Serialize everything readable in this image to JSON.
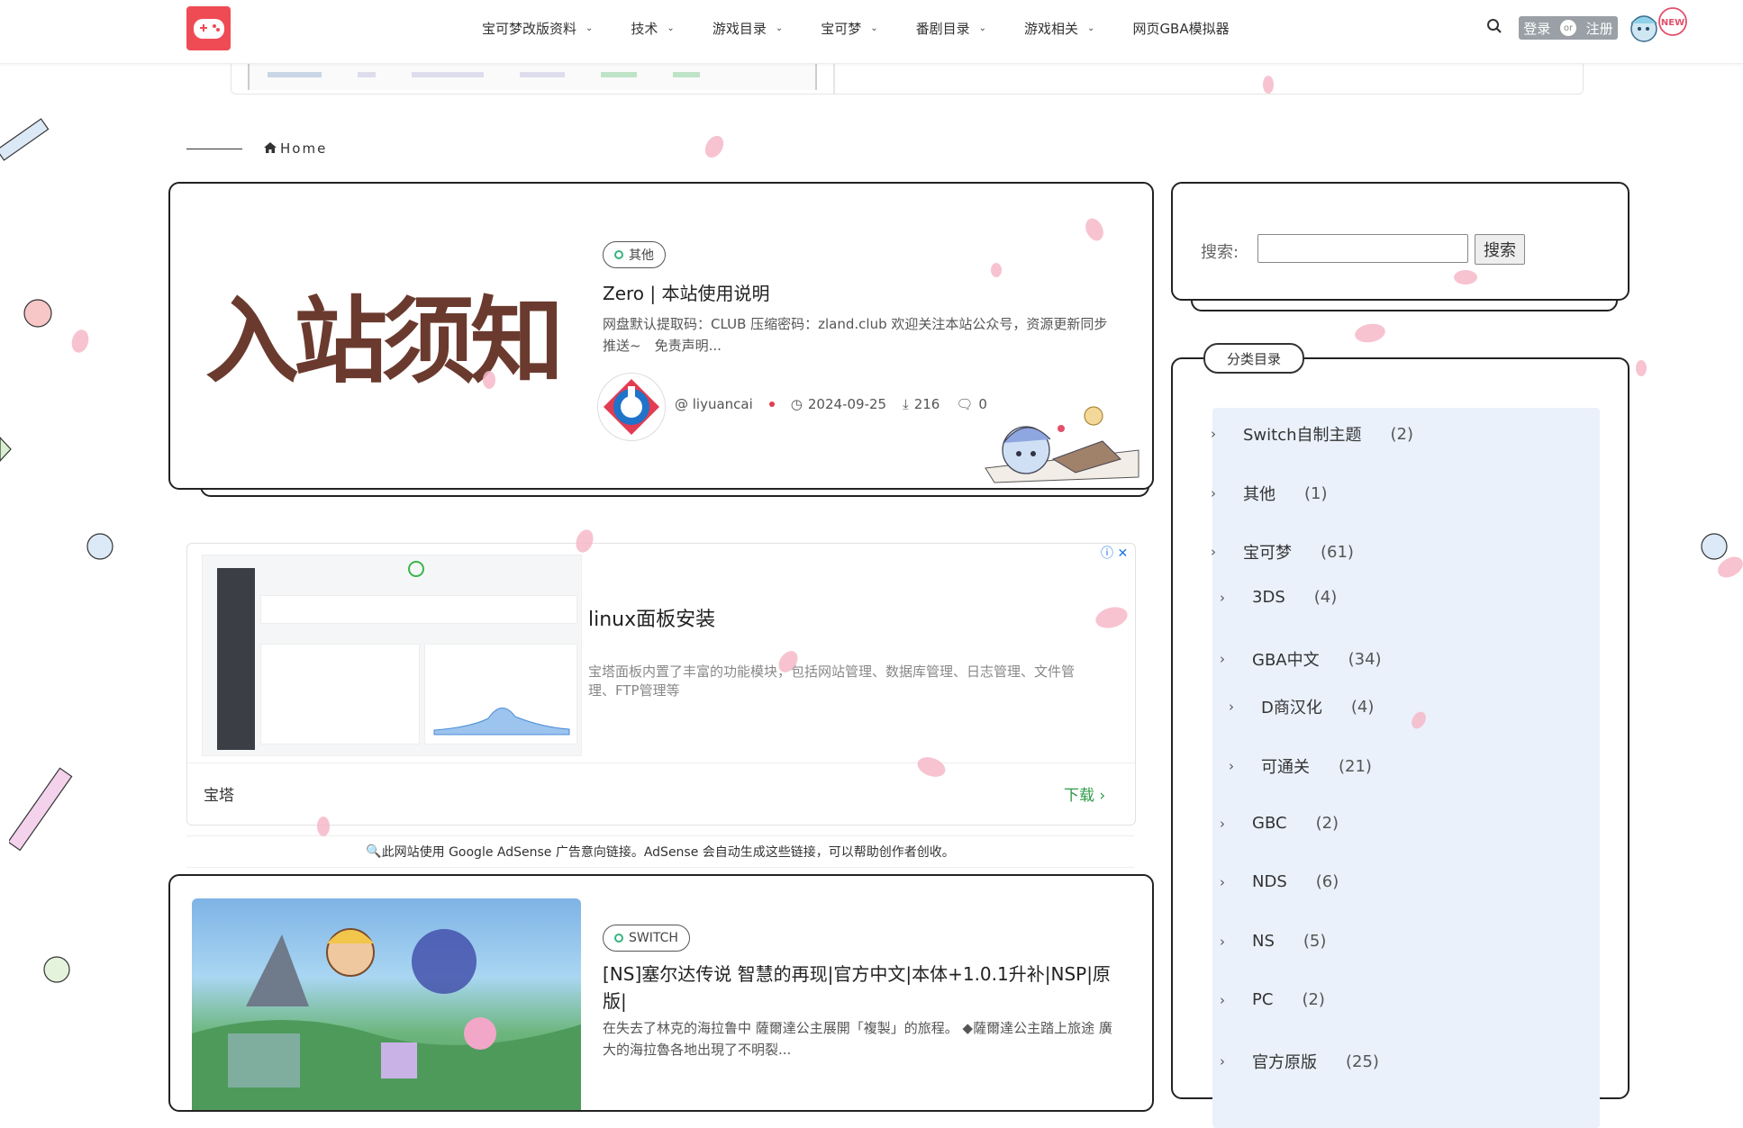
{
  "nav": {
    "items": [
      {
        "label": "宝可梦改版资料",
        "has_dropdown": true
      },
      {
        "label": "技术",
        "has_dropdown": true
      },
      {
        "label": "游戏目录",
        "has_dropdown": true
      },
      {
        "label": "宝可梦",
        "has_dropdown": true
      },
      {
        "label": "番剧目录",
        "has_dropdown": true
      },
      {
        "label": "游戏相关",
        "has_dropdown": true
      },
      {
        "label": "网页GBA模拟器",
        "has_dropdown": false
      }
    ],
    "login_label": "登录",
    "or_label": "or",
    "register_label": "注册",
    "new_badge": "NEW"
  },
  "breadcrumb": {
    "home_label": "Home"
  },
  "posts": [
    {
      "thumb_text": "入站须知",
      "category": "其他",
      "title": "Zero | 本站使用说明",
      "excerpt": "网盘默认提取码：CLUB 压缩密码：zland.club 欢迎关注本站公众号，资源更新同步推送~　免责声明...",
      "author": "@ liyuancai",
      "date": "2024-09-25",
      "downloads": "216",
      "comments": "0"
    },
    {
      "category": "SWITCH",
      "title": "[NS]塞尔达传说 智慧的再现|官方中文|本体+1.0.1升补|NSP|原版|",
      "excerpt": "在失去了林克的海拉鲁中 薩爾達公主展開「複製」的旅程。 ◆薩爾達公主踏上旅途 廣大的海拉魯各地出現了不明裂..."
    }
  ],
  "ad": {
    "title": "linux面板安装",
    "description": "宝塔面板内置了丰富的功能模块，包括网站管理、数据库管理、日志管理、文件管理、FTP管理等",
    "brand": "宝塔",
    "download_label": "下载",
    "adsense_note": "此网站使用 Google AdSense 广告意向链接。AdSense 会自动生成这些链接，可以帮助创作者创收。"
  },
  "sidebar": {
    "search_label": "搜索:",
    "search_value": "",
    "search_button": "搜索",
    "categories_title": "分类目录",
    "categories": [
      {
        "name": "Switch自制主题",
        "count": "(2)"
      },
      {
        "name": "其他",
        "count": "(1)"
      },
      {
        "name": "宝可梦",
        "count": "(61)"
      },
      {
        "name": "3DS",
        "count": "(4)"
      },
      {
        "name": "GBA中文",
        "count": "(34)"
      },
      {
        "name": "D商汉化",
        "count": "(4)"
      },
      {
        "name": "可通关",
        "count": "(21)"
      },
      {
        "name": "GBC",
        "count": "(2)"
      },
      {
        "name": "NDS",
        "count": "(6)"
      },
      {
        "name": "NS",
        "count": "(5)"
      },
      {
        "name": "PC",
        "count": "(2)"
      },
      {
        "name": "官方原版",
        "count": "(25)"
      }
    ]
  },
  "colors": {
    "logo": "#ef4b55",
    "accent_green": "#2e9b47",
    "category_bg": "#eaf1fb",
    "petal": "#f6b9c9"
  }
}
